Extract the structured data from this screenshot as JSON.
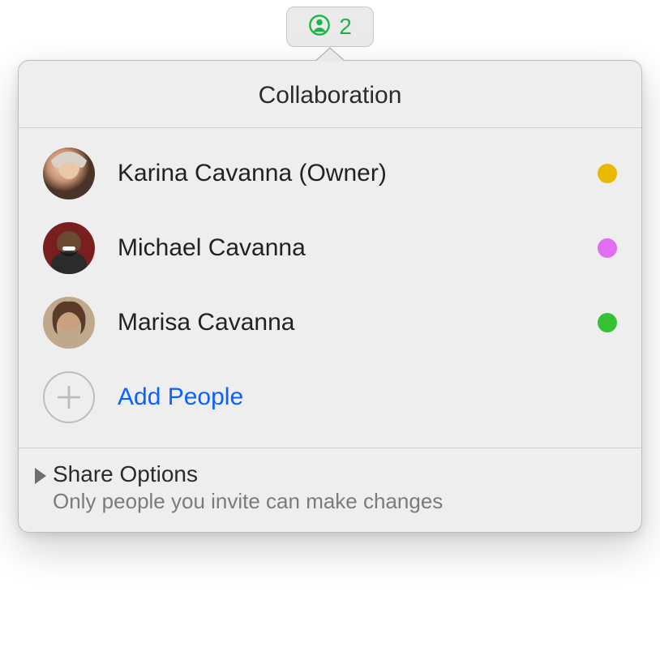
{
  "toolbar": {
    "participant_count": "2",
    "icon_color": "#1fb24a"
  },
  "panel": {
    "title": "Collaboration"
  },
  "participants": [
    {
      "name": "Karina Cavanna (Owner)",
      "dot_color": "#e9b800"
    },
    {
      "name": "Michael Cavanna",
      "dot_color": "#e06ef0"
    },
    {
      "name": "Marisa Cavanna",
      "dot_color": "#34c234"
    }
  ],
  "add": {
    "label": "Add People"
  },
  "share": {
    "title": "Share Options",
    "subtitle": "Only people you invite can make changes"
  }
}
